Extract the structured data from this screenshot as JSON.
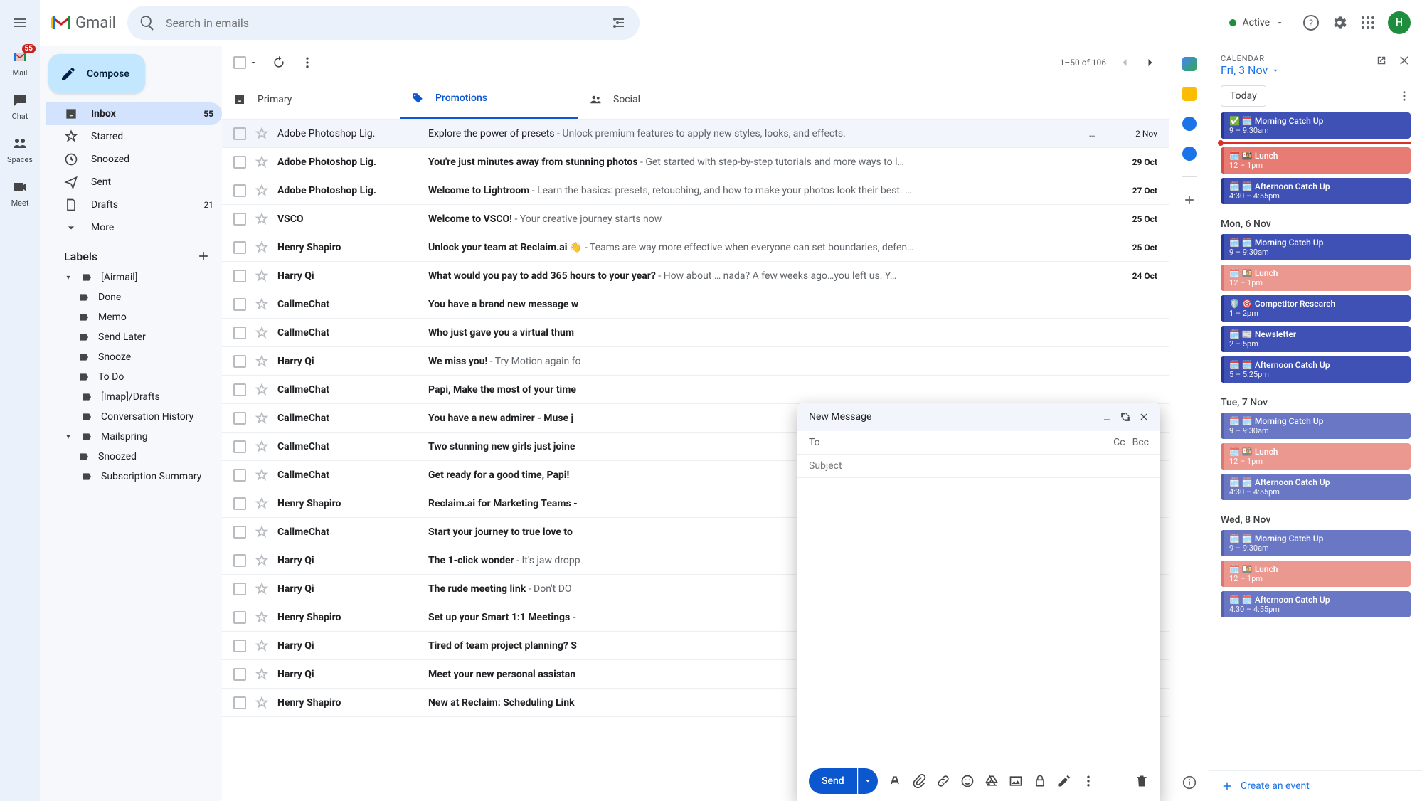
{
  "rail": {
    "mail": "Mail",
    "mail_badge": "55",
    "chat": "Chat",
    "spaces": "Spaces",
    "meet": "Meet"
  },
  "logo": "Gmail",
  "search": {
    "placeholder": "Search in emails"
  },
  "status": {
    "label": "Active"
  },
  "avatar_letter": "H",
  "compose_label": "Compose",
  "nav": {
    "inbox": "Inbox",
    "inbox_count": "55",
    "starred": "Starred",
    "snoozed": "Snoozed",
    "sent": "Sent",
    "drafts": "Drafts",
    "drafts_count": "21",
    "more": "More"
  },
  "labels_header": "Labels",
  "labels": {
    "airmail": "[Airmail]",
    "done": "Done",
    "memo": "Memo",
    "sendlater": "Send Later",
    "snooze": "Snooze",
    "todo": "To Do",
    "imapdrafts": "[Imap]/Drafts",
    "convhist": "Conversation History",
    "mailspring": "Mailspring",
    "snoozed2": "Snoozed",
    "subsum": "Subscription Summary"
  },
  "toolbar": {
    "range": "1–50 of 106"
  },
  "tabs": {
    "primary": "Primary",
    "promotions": "Promotions",
    "social": "Social"
  },
  "emails": [
    {
      "sender": "Adobe Photoshop Lig.",
      "subject": "Explore the power of presets",
      "snippet": " - Unlock premium features to apply new styles, looks, and effects.",
      "date": "2 Nov",
      "unread": false,
      "att": true
    },
    {
      "sender": "Adobe Photoshop Lig.",
      "subject": "You're just minutes away from stunning photos",
      "snippet": " - Get started with step-by-step tutorials and more ways to l…",
      "date": "29 Oct",
      "unread": true,
      "att": false
    },
    {
      "sender": "Adobe Photoshop Lig.",
      "subject": "Welcome to Lightroom",
      "snippet": " - Learn the basics: presets, retouching, and how to make your photos look their best.  …",
      "date": "27 Oct",
      "unread": true,
      "att": false
    },
    {
      "sender": "VSCO",
      "subject": "Welcome to VSCO!",
      "snippet": " - Your creative journey starts now",
      "date": "25 Oct",
      "unread": true,
      "att": false
    },
    {
      "sender": "Henry Shapiro",
      "subject": "Unlock your team at Reclaim.ai 👋",
      "snippet": " - Teams are way more effective when everyone can set boundaries, defen…",
      "date": "25 Oct",
      "unread": true,
      "att": false
    },
    {
      "sender": "Harry Qi",
      "subject": "What would you pay to add 365 hours to your year?",
      "snippet": " - How about … nada?    A few weeks ago…you left us. Y…",
      "date": "24 Oct",
      "unread": true,
      "att": false
    },
    {
      "sender": "CallmeChat",
      "subject": "You have a brand new message w",
      "snippet": "",
      "date": "",
      "unread": true,
      "att": false
    },
    {
      "sender": "CallmeChat",
      "subject": "Who just gave you a virtual thum",
      "snippet": "",
      "date": "",
      "unread": true,
      "att": false
    },
    {
      "sender": "Harry Qi",
      "subject": "We miss you!",
      "snippet": " - Try Motion again fo",
      "date": "",
      "unread": true,
      "att": false
    },
    {
      "sender": "CallmeChat",
      "subject": "Papi, Make the most of your time",
      "snippet": "",
      "date": "",
      "unread": true,
      "att": false
    },
    {
      "sender": "CallmeChat",
      "subject": "You have a new admirer - Muse j",
      "snippet": "",
      "date": "",
      "unread": true,
      "att": false
    },
    {
      "sender": "CallmeChat",
      "subject": "Two stunning new girls just joine",
      "snippet": "",
      "date": "",
      "unread": true,
      "att": false
    },
    {
      "sender": "CallmeChat",
      "subject": "Get ready for a good time, Papi!",
      "snippet": "",
      "date": "",
      "unread": true,
      "att": false
    },
    {
      "sender": "Henry Shapiro",
      "subject": "Reclaim.ai for Marketing Teams -",
      "snippet": "",
      "date": "",
      "unread": true,
      "att": false
    },
    {
      "sender": "CallmeChat",
      "subject": "Start your journey to true love to",
      "snippet": "",
      "date": "",
      "unread": true,
      "att": false
    },
    {
      "sender": "Harry Qi",
      "subject": "The 1-click wonder",
      "snippet": " - It's jaw dropp",
      "date": "",
      "unread": true,
      "att": false
    },
    {
      "sender": "Harry Qi",
      "subject": "The rude meeting link",
      "snippet": " - Don't DO",
      "date": "",
      "unread": true,
      "att": false
    },
    {
      "sender": "Henry Shapiro",
      "subject": "Set up your Smart 1:1 Meetings -",
      "snippet": "",
      "date": "",
      "unread": true,
      "att": false
    },
    {
      "sender": "Harry Qi",
      "subject": "Tired of team project planning? S",
      "snippet": "",
      "date": "",
      "unread": true,
      "att": false
    },
    {
      "sender": "Harry Qi",
      "subject": "Meet your new personal assistan",
      "snippet": "",
      "date": "",
      "unread": true,
      "att": false
    },
    {
      "sender": "Henry Shapiro",
      "subject": "New at Reclaim: Scheduling Link",
      "snippet": "",
      "date": "",
      "unread": true,
      "att": false
    }
  ],
  "composer": {
    "title": "New Message",
    "to": "To",
    "cc": "Cc",
    "bcc": "Bcc",
    "subject_placeholder": "Subject",
    "send": "Send"
  },
  "calendar": {
    "header": "CALENDAR",
    "date": "Fri, 3 Nov",
    "today": "Today",
    "create": "Create an event",
    "days": [
      {
        "label": "",
        "events": [
          {
            "title": "✅ 🗓️ Morning Catch Up",
            "time": "9 – 9:30am",
            "color": "blue",
            "check": true
          },
          {
            "title": "🗓️ 🍱 Lunch",
            "time": "12 – 1pm",
            "color": "red"
          },
          {
            "title": "🗓️ 🗓️ Afternoon Catch Up",
            "time": "4:30 – 4:55pm",
            "color": "blue"
          }
        ]
      },
      {
        "label": "Mon, 6 Nov",
        "events": [
          {
            "title": "🗓️ 🗓️ Morning Catch Up",
            "time": "9 – 9:30am",
            "color": "blue"
          },
          {
            "title": "🗓️ 🍱 Lunch",
            "time": "12 – 1pm",
            "color": "red",
            "faded": true
          },
          {
            "title": "🛡️ 🎯 Competitor Research",
            "time": "1 – 2pm",
            "color": "blue"
          },
          {
            "title": "🗓️ 📰 Newsletter",
            "time": "2 – 5pm",
            "color": "blue"
          },
          {
            "title": "🗓️ 🗓️ Afternoon Catch Up",
            "time": "5 – 5:25pm",
            "color": "blue"
          }
        ]
      },
      {
        "label": "Tue, 7 Nov",
        "events": [
          {
            "title": "🗓️ 🗓️ Morning Catch Up",
            "time": "9 – 9:30am",
            "color": "blue",
            "faded": true
          },
          {
            "title": "🗓️ 🍱 Lunch",
            "time": "12 – 1pm",
            "color": "red",
            "faded": true
          },
          {
            "title": "🗓️ 🗓️ Afternoon Catch Up",
            "time": "4:30 – 4:55pm",
            "color": "blue",
            "faded": true
          }
        ]
      },
      {
        "label": "Wed, 8 Nov",
        "events": [
          {
            "title": "🗓️ 🗓️ Morning Catch Up",
            "time": "9 – 9:30am",
            "color": "blue",
            "faded": true
          },
          {
            "title": "🗓️ 🍱 Lunch",
            "time": "12 – 1pm",
            "color": "red",
            "faded": true
          },
          {
            "title": "🗓️ 🗓️ Afternoon Catch Up",
            "time": "4:30 – 4:55pm",
            "color": "blue",
            "faded": true
          }
        ]
      }
    ]
  }
}
